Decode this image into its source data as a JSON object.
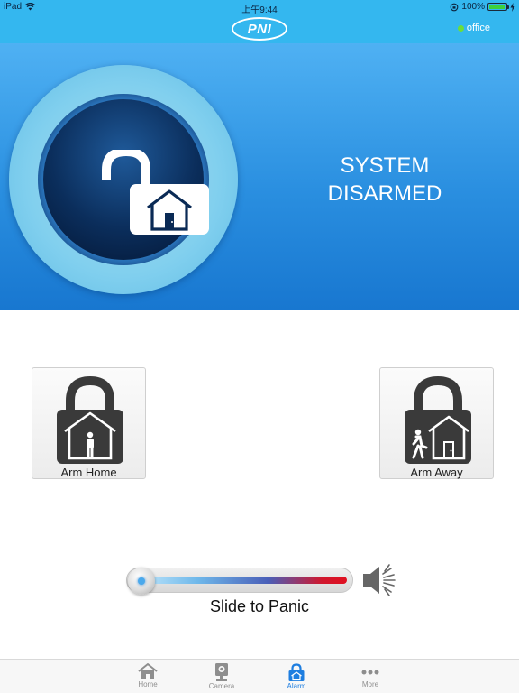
{
  "status_bar": {
    "device": "iPad",
    "time": "上午9:44",
    "battery": "100%"
  },
  "nav": {
    "logo_text": "PNI",
    "location_name": "office",
    "location_status_color": "#6bde3a"
  },
  "hero": {
    "status_line1": "SYSTEM",
    "status_line2": "DISARMED",
    "icon": "lock-open-home-icon"
  },
  "actions": {
    "arm_home_label": "Arm Home",
    "arm_home_icon": "lock-home-person-icon",
    "arm_away_label": "Arm Away",
    "arm_away_icon": "lock-home-walking-icon"
  },
  "panic": {
    "label": "Slide to Panic",
    "icon": "speaker-icon"
  },
  "tabs": [
    {
      "label": "Home",
      "icon": "home-icon",
      "active": false
    },
    {
      "label": "Camera",
      "icon": "camera-icon",
      "active": false
    },
    {
      "label": "Alarm",
      "icon": "alarm-lock-icon",
      "active": true
    },
    {
      "label": "More",
      "icon": "more-icon",
      "active": false
    }
  ],
  "colors": {
    "accent": "#1e7ee0",
    "header": "#34b7ef",
    "panic_red": "#d0182e"
  }
}
